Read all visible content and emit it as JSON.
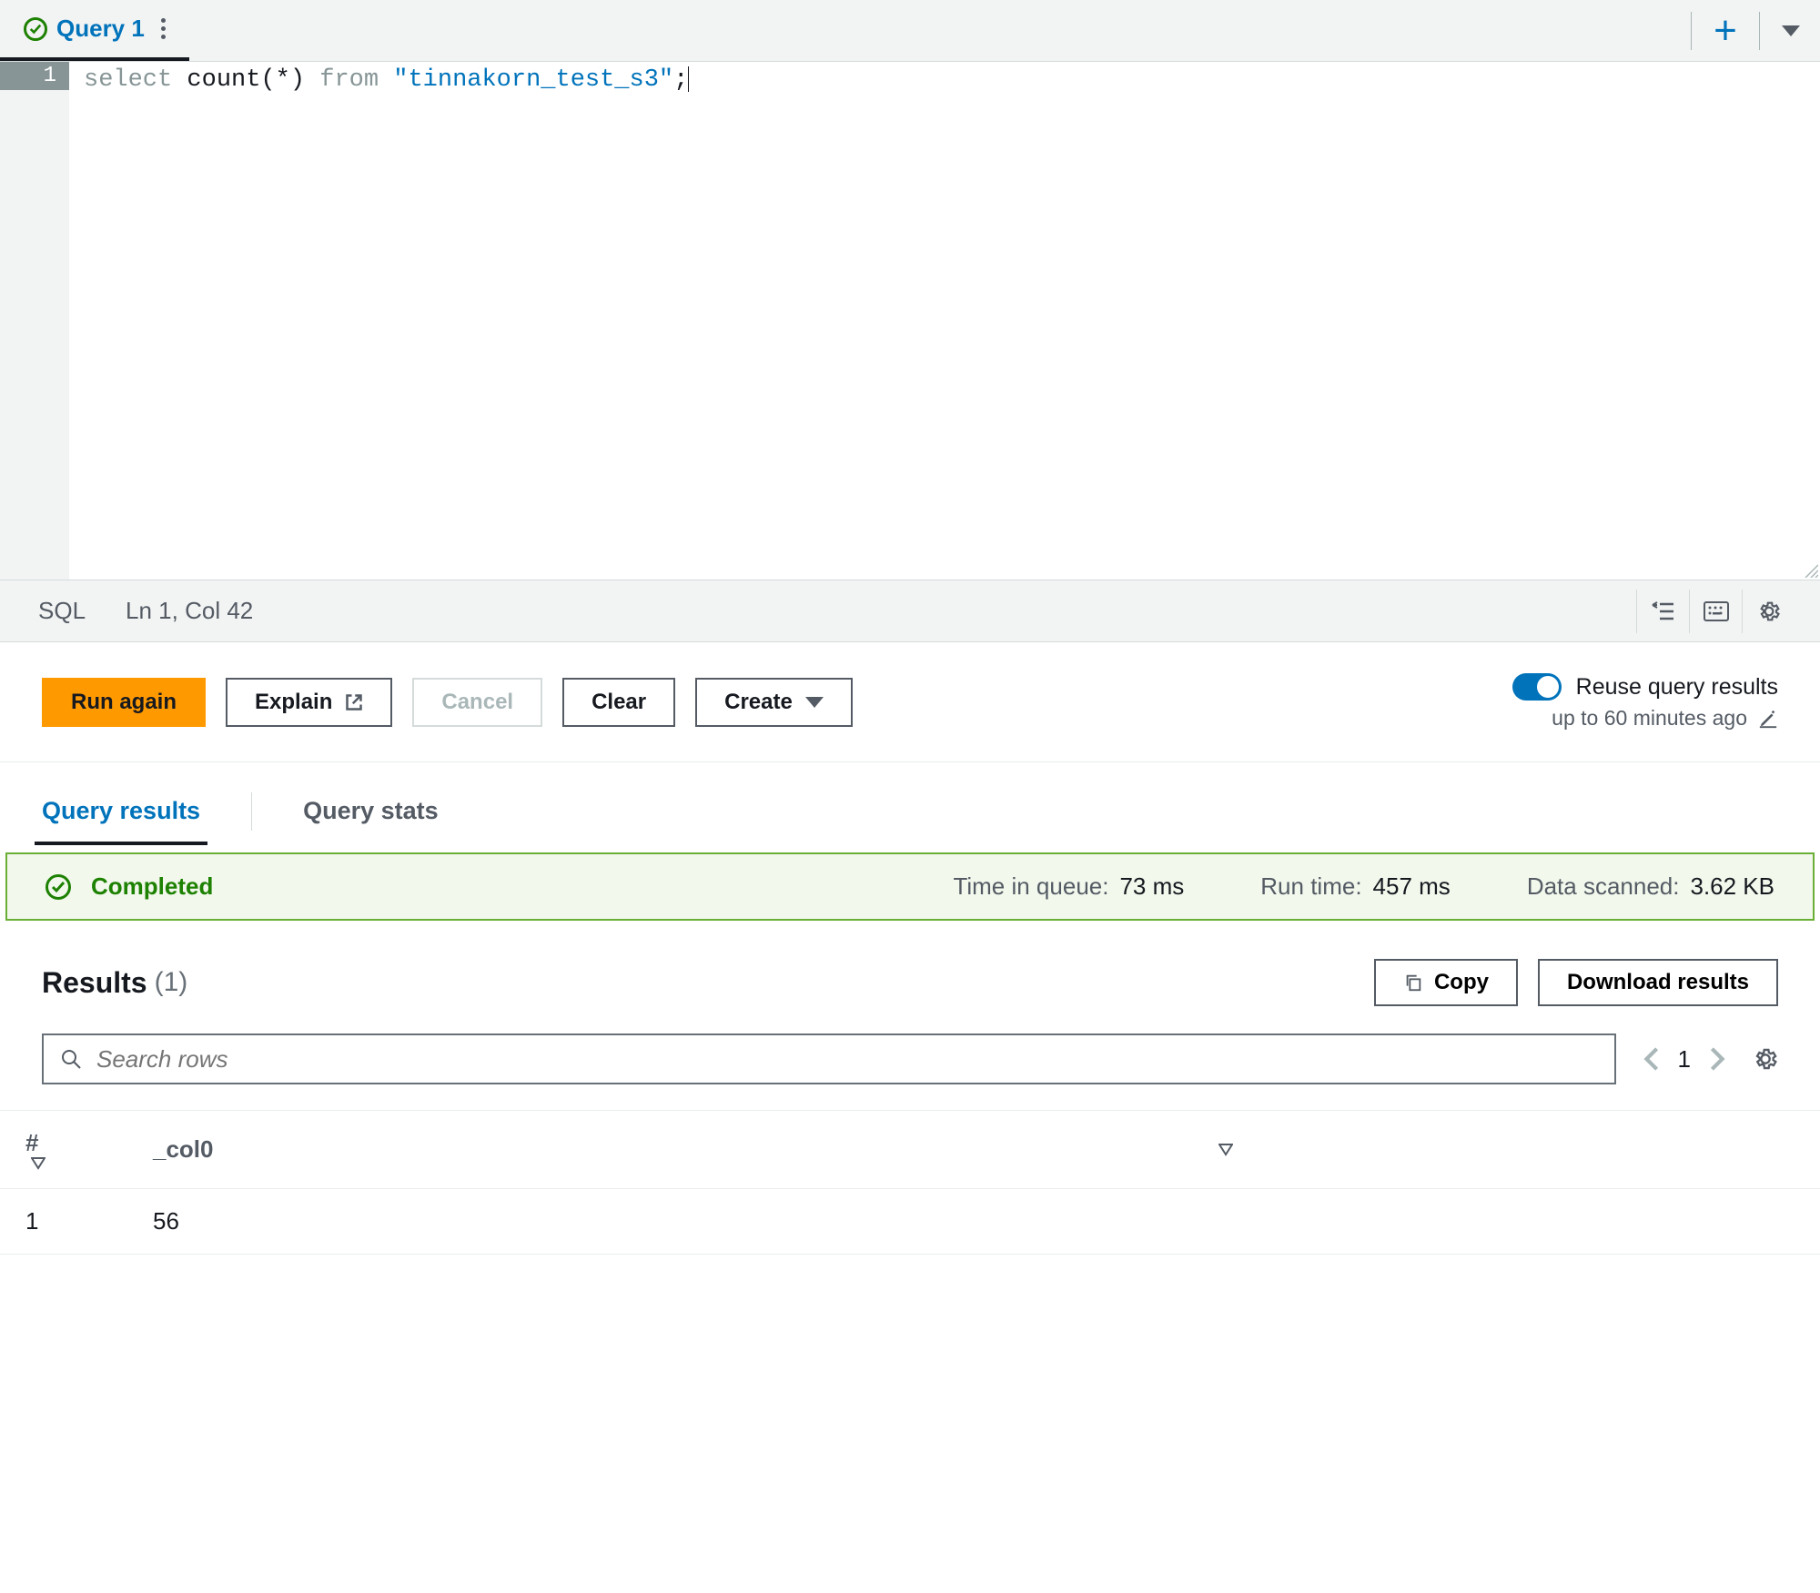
{
  "tab": {
    "label": "Query 1"
  },
  "editor": {
    "lineNumber": "1",
    "code_kw1": "select",
    "code_fn": " count(*) ",
    "code_kw2": "from",
    "code_str": " \"tinnakorn_test_s3\"",
    "code_end": ";"
  },
  "statusbar": {
    "lang": "SQL",
    "position": "Ln 1, Col 42"
  },
  "actions": {
    "run": "Run again",
    "explain": "Explain",
    "cancel": "Cancel",
    "clear": "Clear",
    "create": "Create"
  },
  "reuse": {
    "label": "Reuse query results",
    "sub": "up to 60 minutes ago"
  },
  "resultTabs": {
    "results": "Query results",
    "stats": "Query stats"
  },
  "completed": {
    "status": "Completed",
    "queueLabel": "Time in queue:",
    "queueValue": "73 ms",
    "runLabel": "Run time:",
    "runValue": "457 ms",
    "scanLabel": "Data scanned:",
    "scanValue": "3.62 KB"
  },
  "results": {
    "title": "Results",
    "count": "(1)",
    "copy": "Copy",
    "download": "Download results",
    "searchPlaceholder": "Search rows",
    "page": "1",
    "columns": {
      "num": "#",
      "c1": "_col0"
    },
    "rows": [
      {
        "num": "1",
        "c1": "56"
      }
    ]
  }
}
